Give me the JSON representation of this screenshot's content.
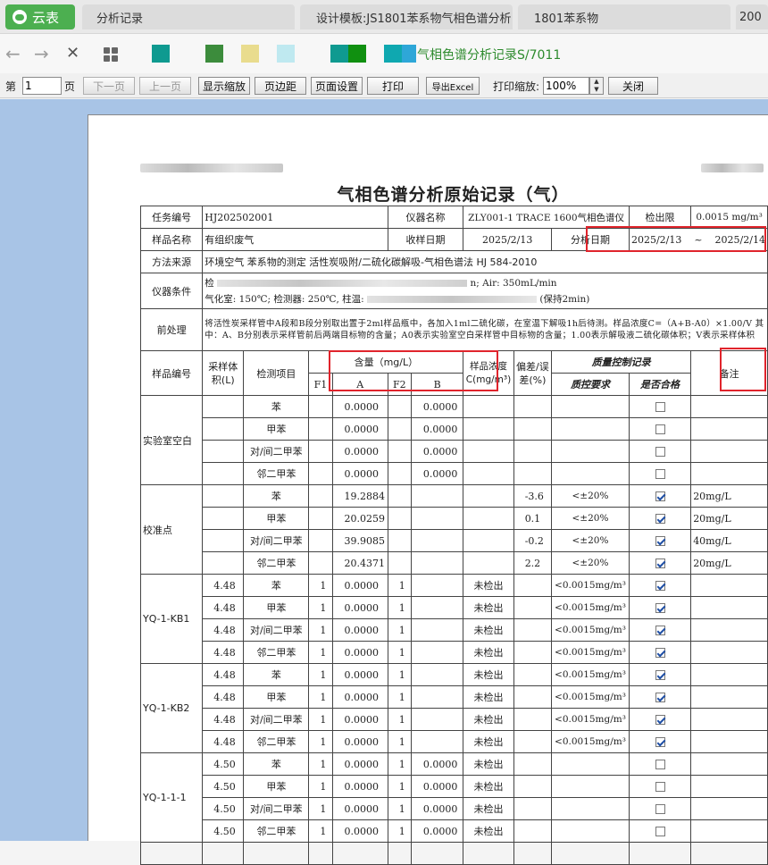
{
  "app": {
    "brand": "云表"
  },
  "tabs": [
    {
      "label": "分析记录"
    },
    {
      "label": "设计模板:JS1801苯系物气相色谱分析"
    },
    {
      "label": "1801苯系物"
    },
    {
      "label": "200"
    }
  ],
  "nav": {
    "back_icon": "←",
    "forward_icon": "→",
    "close_icon": "✕",
    "title": "气相色谱分析记录S/7011",
    "swatches": [
      "#0f9a90",
      "#3c8c3c",
      "#e9dc8e",
      "#bfe9f0",
      "#0f9a90",
      "#109010",
      "#0fa8b0",
      "#2ea7d8"
    ]
  },
  "toolbar": {
    "page_prefix": "第",
    "page_value": "1",
    "page_suffix": "页",
    "next": "下一页",
    "prev": "上一页",
    "fit": "显示缩放",
    "margin": "页边距",
    "setup": "页面设置",
    "print": "打印",
    "export": "导出Excel",
    "print_zoom_label": "打印缩放:",
    "print_zoom": "100%",
    "close": "关闭"
  },
  "doc": {
    "title": "气相色谱分析原始记录（气）",
    "h": {
      "task_no_label": "任务编号",
      "task_no": "HJ202502001",
      "instrument_label": "仪器名称",
      "instrument": "ZLY001-1  TRACE 1600气相色谱仪",
      "detect_limit_label": "检出限",
      "detect_limit": "0.0015 mg/m³",
      "sample_name_label": "样品名称",
      "sample_name": "有组织废气",
      "receive_date_label": "收样日期",
      "receive_date": "2025/2/13",
      "analysis_date_label": "分析日期",
      "analysis_date": "2025/2/13    ~    2025/2/14",
      "method_label": "方法来源",
      "method": "环境空气 苯系物的测定 活性炭吸附/二硫化碳解吸-气相色谱法 HJ 584-2010",
      "cond_label": "仪器条件",
      "cond_line1_start": "检",
      "cond_line1_end": "n; Air: 350mL/min",
      "cond_line2_start": "气化室: 150℃; 检测器: 250℃, 柱温: ",
      "cond_line2_end": " (保持2min)",
      "pre_label": "前处理",
      "pre_text": "将活性炭采样管中A段和B段分别取出置于2ml样品瓶中，各加入1ml二硫化碳，在室温下解吸1h后待测。样品浓度C=（A+B-A0）×1.00/V 其中：A、B分别表示采样管前后两端目标物的含量；A0表示实验室空白采样管中目标物的含量；1.00表示解吸液二硫化碳体积；V表示采样体积"
    },
    "cols": {
      "sample_no": "样品编号",
      "vol": "采样体积(L)",
      "item": "检测项目",
      "content": "含量（mg/L）",
      "conc": "样品浓度C(mg/m³)",
      "dev": "偏差/误差(%)",
      "qc": "质量控制记录",
      "remark": "备注",
      "f1": "F1",
      "a": "A",
      "f2": "F2",
      "b": "B",
      "qc_req": "质控要求",
      "qc_ok": "是否合格"
    },
    "groups": [
      {
        "name": "实验室空白",
        "rows": [
          {
            "vol": "",
            "item": "苯",
            "f1": "",
            "a": "0.0000",
            "f2": "",
            "b": "0.0000",
            "conc": "",
            "dev": "",
            "req": "",
            "ok": false,
            "remark": ""
          },
          {
            "vol": "",
            "item": "甲苯",
            "f1": "",
            "a": "0.0000",
            "f2": "",
            "b": "0.0000",
            "conc": "",
            "dev": "",
            "req": "",
            "ok": false,
            "remark": ""
          },
          {
            "vol": "",
            "item": "对/间二甲苯",
            "f1": "",
            "a": "0.0000",
            "f2": "",
            "b": "0.0000",
            "conc": "",
            "dev": "",
            "req": "",
            "ok": false,
            "remark": ""
          },
          {
            "vol": "",
            "item": "邻二甲苯",
            "f1": "",
            "a": "0.0000",
            "f2": "",
            "b": "0.0000",
            "conc": "",
            "dev": "",
            "req": "",
            "ok": false,
            "remark": ""
          }
        ]
      },
      {
        "name": "校准点",
        "rows": [
          {
            "vol": "",
            "item": "苯",
            "f1": "",
            "a": "19.2884",
            "f2": "",
            "b": "",
            "conc": "",
            "dev": "-3.6",
            "req": "<±20%",
            "ok": true,
            "remark": "20mg/L"
          },
          {
            "vol": "",
            "item": "甲苯",
            "f1": "",
            "a": "20.0259",
            "f2": "",
            "b": "",
            "conc": "",
            "dev": "0.1",
            "req": "<±20%",
            "ok": true,
            "remark": "20mg/L"
          },
          {
            "vol": "",
            "item": "对/间二甲苯",
            "f1": "",
            "a": "39.9085",
            "f2": "",
            "b": "",
            "conc": "",
            "dev": "-0.2",
            "req": "<±20%",
            "ok": true,
            "remark": "40mg/L"
          },
          {
            "vol": "",
            "item": "邻二甲苯",
            "f1": "",
            "a": "20.4371",
            "f2": "",
            "b": "",
            "conc": "",
            "dev": "2.2",
            "req": "<±20%",
            "ok": true,
            "remark": "20mg/L"
          }
        ]
      },
      {
        "name": "YQ-1-KB1",
        "rows": [
          {
            "vol": "4.48",
            "item": "苯",
            "f1": "1",
            "a": "0.0000",
            "f2": "1",
            "b": "",
            "conc": "未检出",
            "dev": "",
            "req": "<0.0015mg/m³",
            "ok": true,
            "remark": ""
          },
          {
            "vol": "4.48",
            "item": "甲苯",
            "f1": "1",
            "a": "0.0000",
            "f2": "1",
            "b": "",
            "conc": "未检出",
            "dev": "",
            "req": "<0.0015mg/m³",
            "ok": true,
            "remark": ""
          },
          {
            "vol": "4.48",
            "item": "对/间二甲苯",
            "f1": "1",
            "a": "0.0000",
            "f2": "1",
            "b": "",
            "conc": "未检出",
            "dev": "",
            "req": "<0.0015mg/m³",
            "ok": true,
            "remark": ""
          },
          {
            "vol": "4.48",
            "item": "邻二甲苯",
            "f1": "1",
            "a": "0.0000",
            "f2": "1",
            "b": "",
            "conc": "未检出",
            "dev": "",
            "req": "<0.0015mg/m³",
            "ok": true,
            "remark": ""
          }
        ]
      },
      {
        "name": "YQ-1-KB2",
        "rows": [
          {
            "vol": "4.48",
            "item": "苯",
            "f1": "1",
            "a": "0.0000",
            "f2": "1",
            "b": "",
            "conc": "未检出",
            "dev": "",
            "req": "<0.0015mg/m³",
            "ok": true,
            "remark": ""
          },
          {
            "vol": "4.48",
            "item": "甲苯",
            "f1": "1",
            "a": "0.0000",
            "f2": "1",
            "b": "",
            "conc": "未检出",
            "dev": "",
            "req": "<0.0015mg/m³",
            "ok": true,
            "remark": ""
          },
          {
            "vol": "4.48",
            "item": "对/间二甲苯",
            "f1": "1",
            "a": "0.0000",
            "f2": "1",
            "b": "",
            "conc": "未检出",
            "dev": "",
            "req": "<0.0015mg/m³",
            "ok": true,
            "remark": ""
          },
          {
            "vol": "4.48",
            "item": "邻二甲苯",
            "f1": "1",
            "a": "0.0000",
            "f2": "1",
            "b": "",
            "conc": "未检出",
            "dev": "",
            "req": "<0.0015mg/m³",
            "ok": true,
            "remark": ""
          }
        ]
      },
      {
        "name": "YQ-1-1-1",
        "rows": [
          {
            "vol": "4.50",
            "item": "苯",
            "f1": "1",
            "a": "0.0000",
            "f2": "1",
            "b": "0.0000",
            "conc": "未检出",
            "dev": "",
            "req": "",
            "ok": false,
            "remark": ""
          },
          {
            "vol": "4.50",
            "item": "甲苯",
            "f1": "1",
            "a": "0.0000",
            "f2": "1",
            "b": "0.0000",
            "conc": "未检出",
            "dev": "",
            "req": "",
            "ok": false,
            "remark": ""
          },
          {
            "vol": "4.50",
            "item": "对/间二甲苯",
            "f1": "1",
            "a": "0.0000",
            "f2": "1",
            "b": "0.0000",
            "conc": "未检出",
            "dev": "",
            "req": "",
            "ok": false,
            "remark": ""
          },
          {
            "vol": "4.50",
            "item": "邻二甲苯",
            "f1": "1",
            "a": "0.0000",
            "f2": "1",
            "b": "0.0000",
            "conc": "未检出",
            "dev": "",
            "req": "",
            "ok": false,
            "remark": ""
          }
        ]
      }
    ]
  }
}
